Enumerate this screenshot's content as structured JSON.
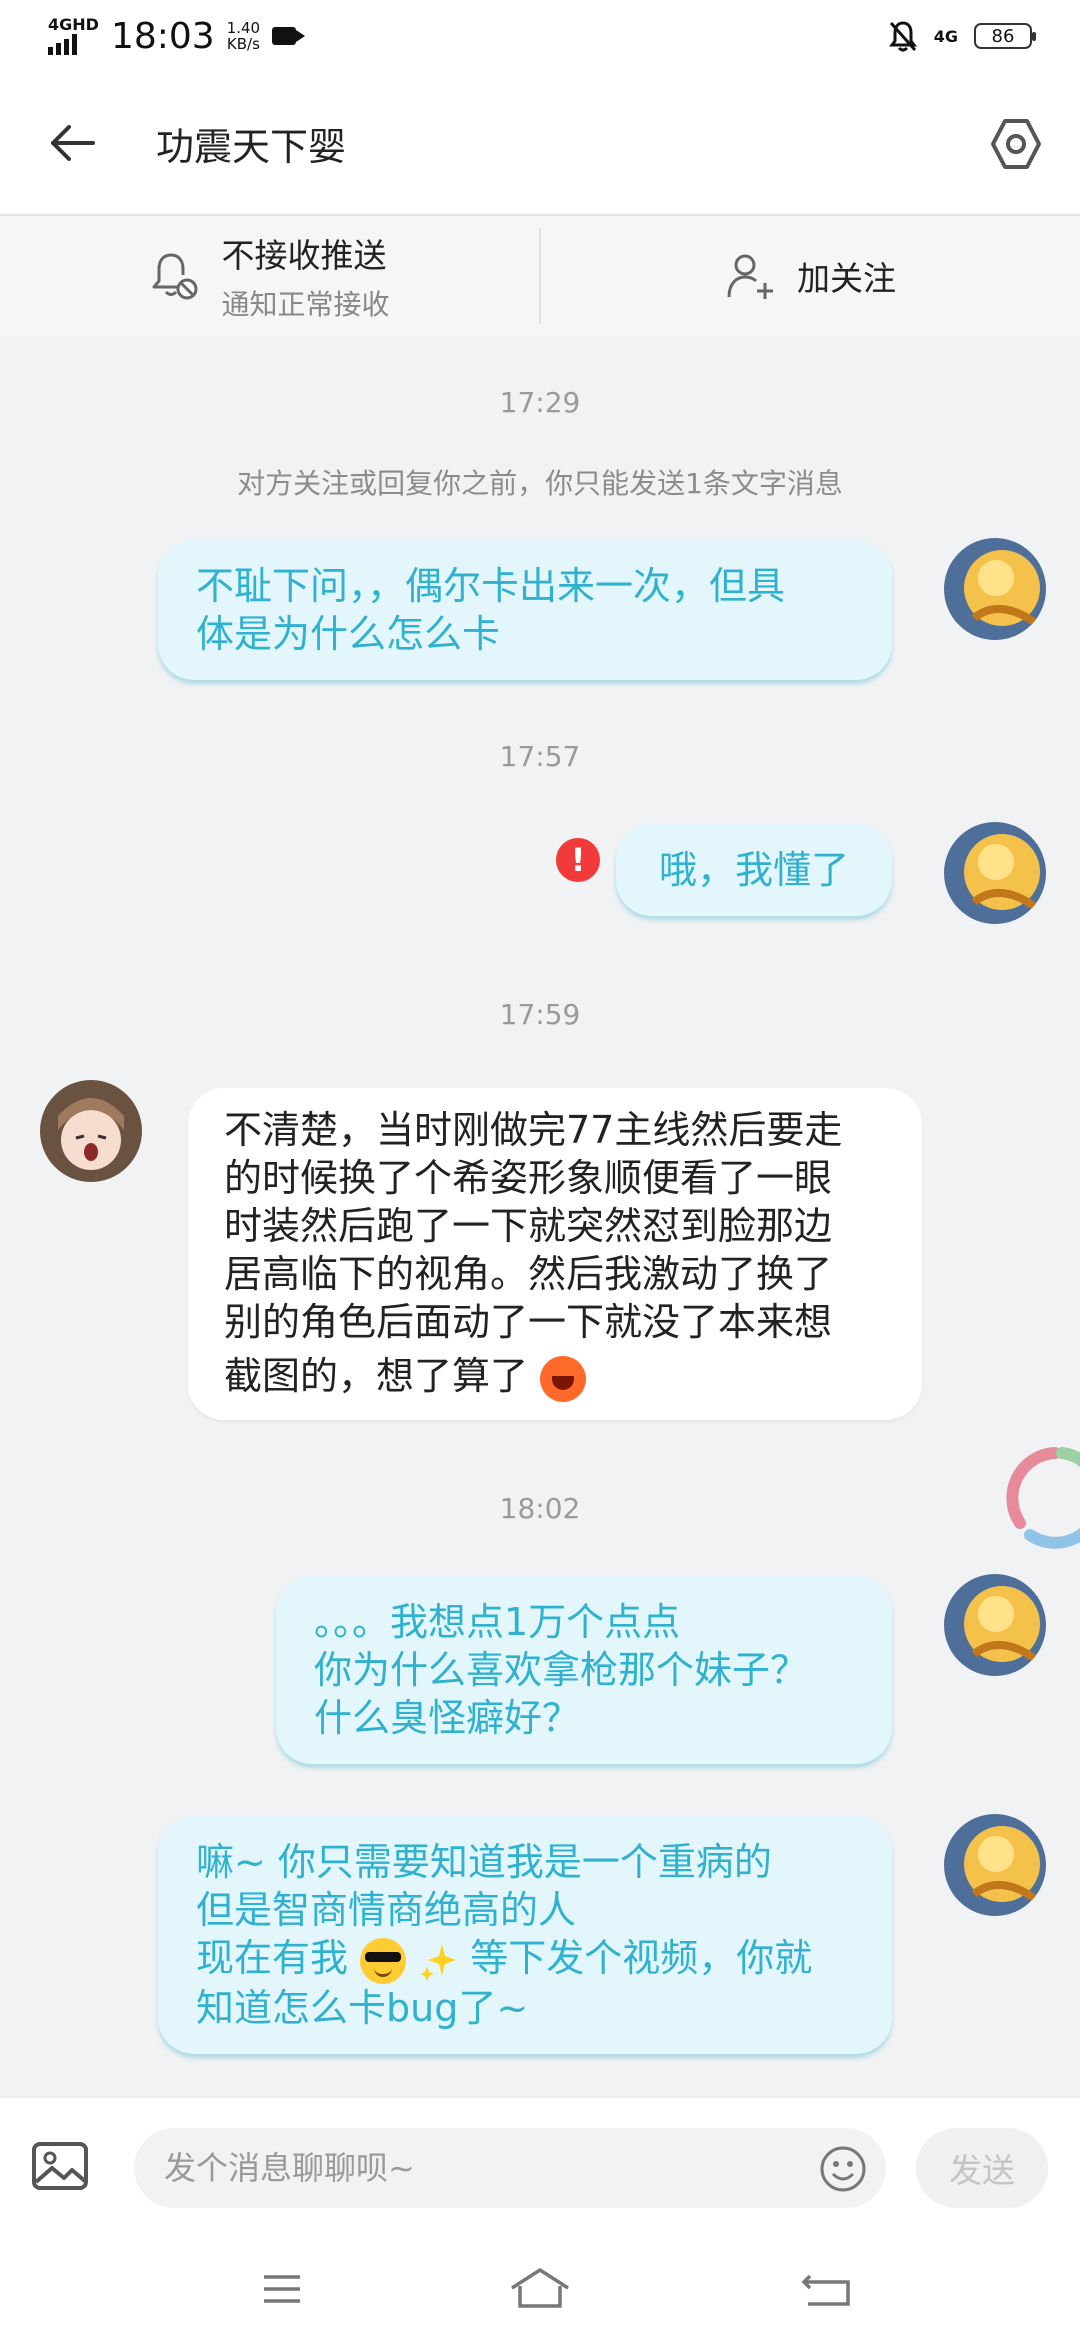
{
  "status_bar": {
    "network_left": "4GHD",
    "time": "18:03",
    "speed_value": "1.40",
    "speed_unit": "KB/s",
    "network_right": "4G",
    "battery": "86"
  },
  "header": {
    "title": "功震天下婴"
  },
  "action_bar": {
    "push_label": "不接收推送",
    "push_sub": "通知正常接收",
    "follow_label": "加关注"
  },
  "chat": {
    "time_1": "17:29",
    "notice": "对方关注或回复你之前，你只能发送1条文字消息",
    "msg_1_line_1": "不耻下问，，偶尔卡出来一次，但具",
    "msg_1_line_2": "体是为什么怎么卡",
    "time_2": "17:57",
    "error_mark": "!",
    "msg_2": "哦，我懂了",
    "time_3": "17:59",
    "msg_3_line_1": "不清楚，当时刚做完77主线然后要走",
    "msg_3_line_2": "的时候换了个希姿形象顺便看了一眼",
    "msg_3_line_3": "时装然后跑了一下就突然怼到脸那边",
    "msg_3_line_4": "居高临下的视角。然后我激动了换了",
    "msg_3_line_5": "别的角色后面动了一下就没了本来想",
    "msg_3_line_6": "截图的，想了算了",
    "time_4": "18:02",
    "msg_4_line_1": "。。。我想点1万个点点",
    "msg_4_line_2": "你为什么喜欢拿枪那个妹子？",
    "msg_4_line_3": "什么臭怪癖好？",
    "msg_5_line_1": "嘛~  你只需要知道我是一个重病的",
    "msg_5_line_2": "但是智商情商绝高的人",
    "msg_5_line_3a": "现在有我",
    "msg_5_line_3b": "等下发个视频，你就",
    "msg_5_line_4": "知道怎么卡bug了~"
  },
  "input_bar": {
    "placeholder": "发个消息聊聊呗~",
    "send_label": "发送"
  },
  "colors": {
    "accent": "#2fb1cf",
    "my_bubble": "#e2f6fc",
    "error": "#f23a3a"
  },
  "icons": [
    "back-arrow-icon",
    "settings-hexagon-icon",
    "bell-muted-icon",
    "add-user-icon",
    "error-icon",
    "image-icon",
    "emoji-face-icon",
    "menu-icon",
    "home-icon",
    "return-icon"
  ]
}
